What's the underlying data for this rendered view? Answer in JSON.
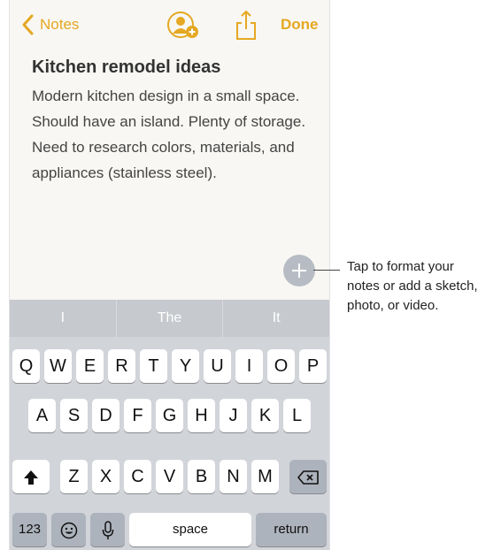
{
  "nav": {
    "back_label": "Notes",
    "done_label": "Done",
    "accent_color": "#e5a822"
  },
  "note": {
    "title": "Kitchen remodel ideas",
    "body": "Modern kitchen design in a small space. Should have an island. Plenty of storage. Need to research colors, materials, and appliances (stainless steel)."
  },
  "keyboard": {
    "predictions": [
      "I",
      "The",
      "It"
    ],
    "row1": [
      "Q",
      "W",
      "E",
      "R",
      "T",
      "Y",
      "U",
      "I",
      "O",
      "P"
    ],
    "row2": [
      "A",
      "S",
      "D",
      "F",
      "G",
      "H",
      "J",
      "K",
      "L"
    ],
    "row3": [
      "Z",
      "X",
      "C",
      "V",
      "B",
      "N",
      "M"
    ],
    "numbers_label": "123",
    "space_label": "space",
    "return_label": "return",
    "icons": {
      "shift": "shift-arrow-icon",
      "delete": "backspace-icon",
      "emoji": "emoji-face-icon",
      "mic": "microphone-icon"
    }
  },
  "callout": {
    "text": "Tap to format your notes or add a sketch, photo, or video."
  }
}
